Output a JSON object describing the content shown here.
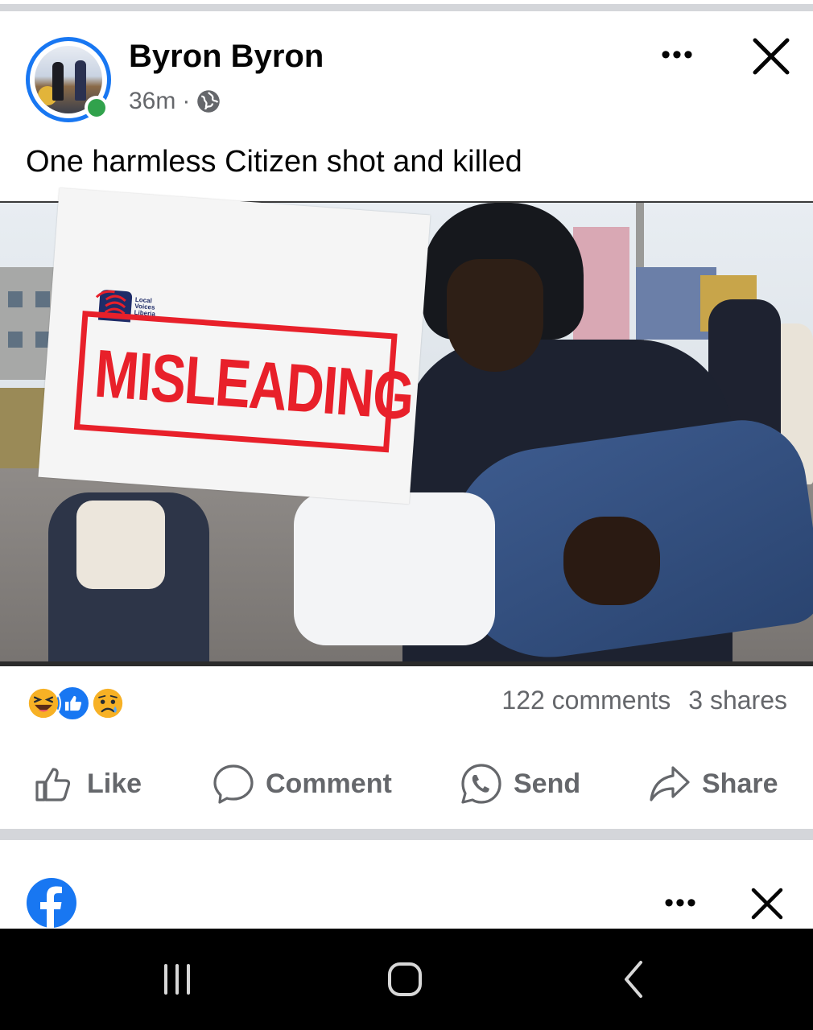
{
  "post": {
    "author": "Byron Byron",
    "time": "36m",
    "separator": "·",
    "privacy_icon": "globe-icon",
    "text": "One harmless Citizen shot and killed",
    "image": {
      "overlay_logo_text": "Local\nVoices\nLiberia",
      "overlay_stamp": "MISLEADING",
      "stamp_color": "#e8202a"
    },
    "reactions": [
      "haha-icon",
      "like-icon",
      "sad-icon"
    ],
    "comments_count": "122 comments",
    "shares_count": "3 shares",
    "actions": {
      "like": "Like",
      "comment": "Comment",
      "send": "Send",
      "share": "Share"
    }
  },
  "next_post": {
    "avatar_icon": "facebook-logo-icon"
  },
  "colors": {
    "accent": "#1877f2",
    "online": "#31a24c",
    "secondary_text": "#65676b",
    "separator": "#d4d6da"
  },
  "android_nav": [
    "recent-apps-icon",
    "home-icon",
    "back-icon"
  ]
}
